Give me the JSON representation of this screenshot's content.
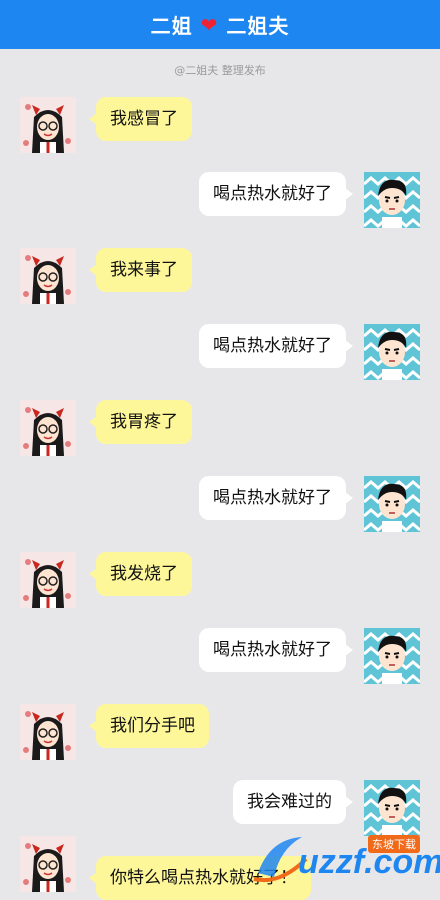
{
  "header": {
    "left_name": "二姐",
    "right_name": "二姐夫",
    "heart_icon": "heart-icon"
  },
  "credit": "@二姐夫 整理发布",
  "messages": [
    {
      "side": "left",
      "text": "我感冒了"
    },
    {
      "side": "right",
      "text": "喝点热水就好了"
    },
    {
      "side": "left",
      "text": "我来事了"
    },
    {
      "side": "right",
      "text": "喝点热水就好了"
    },
    {
      "side": "left",
      "text": "我胃疼了"
    },
    {
      "side": "right",
      "text": "喝点热水就好了"
    },
    {
      "side": "left",
      "text": "我发烧了"
    },
    {
      "side": "right",
      "text": "喝点热水就好了"
    },
    {
      "side": "left",
      "text": "我们分手吧"
    },
    {
      "side": "right",
      "text": "我会难过的"
    },
    {
      "side": "left",
      "text": "你特么喝点热水就好了！"
    }
  ],
  "watermark": {
    "text": "uzzf.com",
    "badge": "东坡下载"
  },
  "colors": {
    "header": "#1e86f0",
    "left_bubble": "#fdf79a",
    "right_bubble": "#ffffff",
    "background": "#e7e7ea"
  }
}
